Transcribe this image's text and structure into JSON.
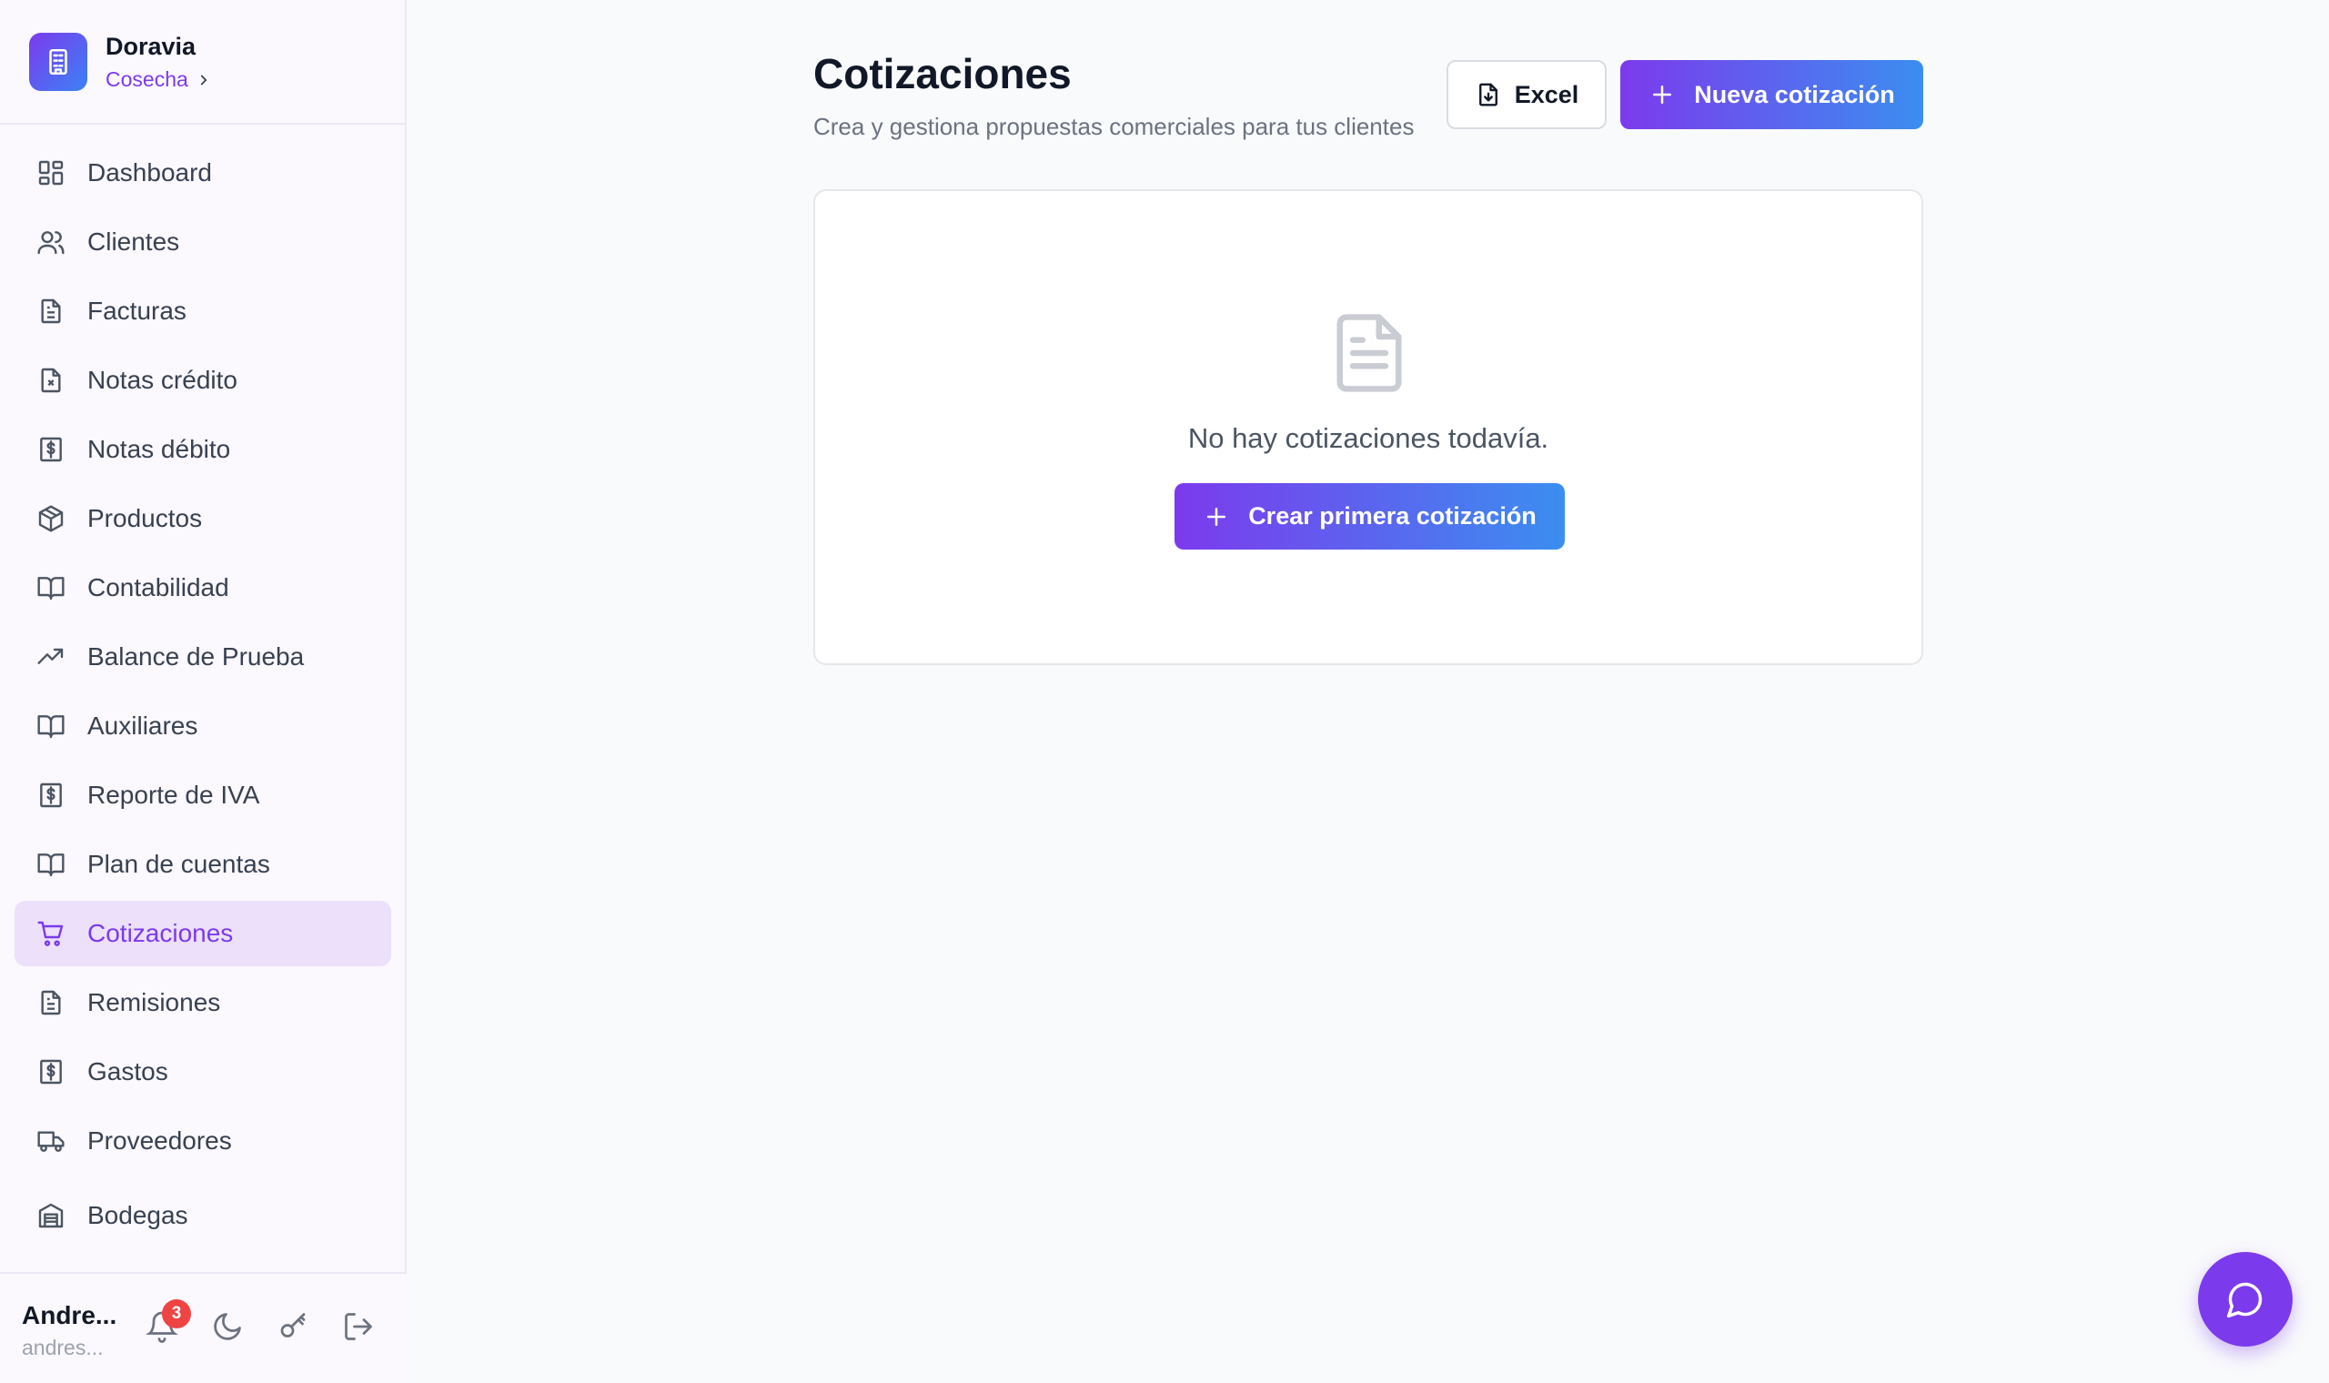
{
  "brand": {
    "name": "Doravia",
    "org": "Cosecha"
  },
  "nav": {
    "items": [
      {
        "label": "Dashboard",
        "icon": "dashboard-icon"
      },
      {
        "label": "Clientes",
        "icon": "users-icon"
      },
      {
        "label": "Facturas",
        "icon": "file-text-icon"
      },
      {
        "label": "Notas crédito",
        "icon": "file-x-icon"
      },
      {
        "label": "Notas débito",
        "icon": "receipt-dollar-icon"
      },
      {
        "label": "Productos",
        "icon": "package-icon"
      },
      {
        "label": "Contabilidad",
        "icon": "book-open-icon"
      },
      {
        "label": "Balance de Prueba",
        "icon": "trending-up-icon"
      },
      {
        "label": "Auxiliares",
        "icon": "book-open-icon"
      },
      {
        "label": "Reporte de IVA",
        "icon": "receipt-dollar-icon"
      },
      {
        "label": "Plan de cuentas",
        "icon": "book-open-icon"
      },
      {
        "label": "Cotizaciones",
        "icon": "shopping-cart-icon",
        "active": true
      },
      {
        "label": "Remisiones",
        "icon": "file-text-icon"
      },
      {
        "label": "Gastos",
        "icon": "receipt-dollar-icon"
      },
      {
        "label": "Proveedores",
        "icon": "truck-icon"
      },
      {
        "label": "Bodegas",
        "icon": "warehouse-icon"
      }
    ]
  },
  "user": {
    "name": "Andre...",
    "email": "andres...",
    "notifications": "3"
  },
  "page": {
    "title": "Cotizaciones",
    "subtitle": "Crea y gestiona propuestas comerciales para tus clientes",
    "excel_label": "Excel",
    "new_label": "Nueva cotización"
  },
  "empty": {
    "message": "No hay cotizaciones todavía.",
    "cta_label": "Crear primera cotización"
  },
  "colors": {
    "accent": "#7c3aed",
    "accent_end": "#3b8ef0",
    "active_bg": "#ece0fb",
    "badge": "#ef4444"
  }
}
